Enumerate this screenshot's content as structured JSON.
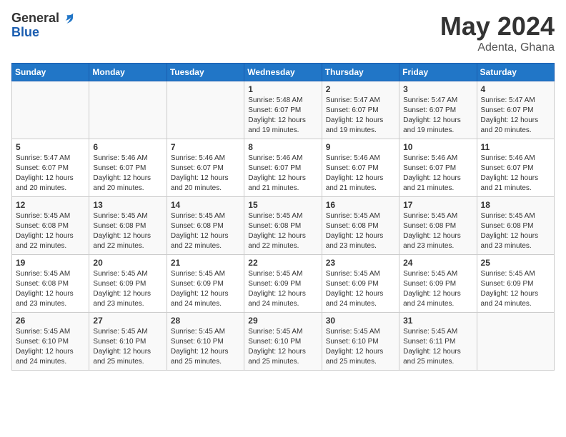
{
  "header": {
    "logo_general": "General",
    "logo_blue": "Blue",
    "month_year": "May 2024",
    "location": "Adenta, Ghana"
  },
  "days_of_week": [
    "Sunday",
    "Monday",
    "Tuesday",
    "Wednesday",
    "Thursday",
    "Friday",
    "Saturday"
  ],
  "weeks": [
    [
      {
        "day": "",
        "info": ""
      },
      {
        "day": "",
        "info": ""
      },
      {
        "day": "",
        "info": ""
      },
      {
        "day": "1",
        "info": "Sunrise: 5:48 AM\nSunset: 6:07 PM\nDaylight: 12 hours\nand 19 minutes."
      },
      {
        "day": "2",
        "info": "Sunrise: 5:47 AM\nSunset: 6:07 PM\nDaylight: 12 hours\nand 19 minutes."
      },
      {
        "day": "3",
        "info": "Sunrise: 5:47 AM\nSunset: 6:07 PM\nDaylight: 12 hours\nand 19 minutes."
      },
      {
        "day": "4",
        "info": "Sunrise: 5:47 AM\nSunset: 6:07 PM\nDaylight: 12 hours\nand 20 minutes."
      }
    ],
    [
      {
        "day": "5",
        "info": "Sunrise: 5:47 AM\nSunset: 6:07 PM\nDaylight: 12 hours\nand 20 minutes."
      },
      {
        "day": "6",
        "info": "Sunrise: 5:46 AM\nSunset: 6:07 PM\nDaylight: 12 hours\nand 20 minutes."
      },
      {
        "day": "7",
        "info": "Sunrise: 5:46 AM\nSunset: 6:07 PM\nDaylight: 12 hours\nand 20 minutes."
      },
      {
        "day": "8",
        "info": "Sunrise: 5:46 AM\nSunset: 6:07 PM\nDaylight: 12 hours\nand 21 minutes."
      },
      {
        "day": "9",
        "info": "Sunrise: 5:46 AM\nSunset: 6:07 PM\nDaylight: 12 hours\nand 21 minutes."
      },
      {
        "day": "10",
        "info": "Sunrise: 5:46 AM\nSunset: 6:07 PM\nDaylight: 12 hours\nand 21 minutes."
      },
      {
        "day": "11",
        "info": "Sunrise: 5:46 AM\nSunset: 6:07 PM\nDaylight: 12 hours\nand 21 minutes."
      }
    ],
    [
      {
        "day": "12",
        "info": "Sunrise: 5:45 AM\nSunset: 6:08 PM\nDaylight: 12 hours\nand 22 minutes."
      },
      {
        "day": "13",
        "info": "Sunrise: 5:45 AM\nSunset: 6:08 PM\nDaylight: 12 hours\nand 22 minutes."
      },
      {
        "day": "14",
        "info": "Sunrise: 5:45 AM\nSunset: 6:08 PM\nDaylight: 12 hours\nand 22 minutes."
      },
      {
        "day": "15",
        "info": "Sunrise: 5:45 AM\nSunset: 6:08 PM\nDaylight: 12 hours\nand 22 minutes."
      },
      {
        "day": "16",
        "info": "Sunrise: 5:45 AM\nSunset: 6:08 PM\nDaylight: 12 hours\nand 23 minutes."
      },
      {
        "day": "17",
        "info": "Sunrise: 5:45 AM\nSunset: 6:08 PM\nDaylight: 12 hours\nand 23 minutes."
      },
      {
        "day": "18",
        "info": "Sunrise: 5:45 AM\nSunset: 6:08 PM\nDaylight: 12 hours\nand 23 minutes."
      }
    ],
    [
      {
        "day": "19",
        "info": "Sunrise: 5:45 AM\nSunset: 6:08 PM\nDaylight: 12 hours\nand 23 minutes."
      },
      {
        "day": "20",
        "info": "Sunrise: 5:45 AM\nSunset: 6:09 PM\nDaylight: 12 hours\nand 23 minutes."
      },
      {
        "day": "21",
        "info": "Sunrise: 5:45 AM\nSunset: 6:09 PM\nDaylight: 12 hours\nand 24 minutes."
      },
      {
        "day": "22",
        "info": "Sunrise: 5:45 AM\nSunset: 6:09 PM\nDaylight: 12 hours\nand 24 minutes."
      },
      {
        "day": "23",
        "info": "Sunrise: 5:45 AM\nSunset: 6:09 PM\nDaylight: 12 hours\nand 24 minutes."
      },
      {
        "day": "24",
        "info": "Sunrise: 5:45 AM\nSunset: 6:09 PM\nDaylight: 12 hours\nand 24 minutes."
      },
      {
        "day": "25",
        "info": "Sunrise: 5:45 AM\nSunset: 6:09 PM\nDaylight: 12 hours\nand 24 minutes."
      }
    ],
    [
      {
        "day": "26",
        "info": "Sunrise: 5:45 AM\nSunset: 6:10 PM\nDaylight: 12 hours\nand 24 minutes."
      },
      {
        "day": "27",
        "info": "Sunrise: 5:45 AM\nSunset: 6:10 PM\nDaylight: 12 hours\nand 25 minutes."
      },
      {
        "day": "28",
        "info": "Sunrise: 5:45 AM\nSunset: 6:10 PM\nDaylight: 12 hours\nand 25 minutes."
      },
      {
        "day": "29",
        "info": "Sunrise: 5:45 AM\nSunset: 6:10 PM\nDaylight: 12 hours\nand 25 minutes."
      },
      {
        "day": "30",
        "info": "Sunrise: 5:45 AM\nSunset: 6:10 PM\nDaylight: 12 hours\nand 25 minutes."
      },
      {
        "day": "31",
        "info": "Sunrise: 5:45 AM\nSunset: 6:11 PM\nDaylight: 12 hours\nand 25 minutes."
      },
      {
        "day": "",
        "info": ""
      }
    ]
  ]
}
